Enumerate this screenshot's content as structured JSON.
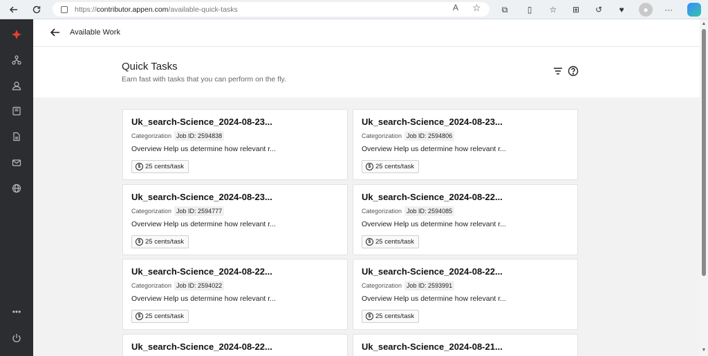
{
  "browser": {
    "url_prefix": "https://",
    "url_host": "contributor.appen.com",
    "url_path": "/available-quick-tasks",
    "read_aloud_label": "A"
  },
  "topbar": {
    "title": "Available Work"
  },
  "header": {
    "title": "Quick Tasks",
    "subtitle": "Earn fast with tasks that you can perform on the fly."
  },
  "tasks": [
    {
      "title": "Uk_search-Science_2024-08-23...",
      "category": "Categorization",
      "job_id": "Job ID: 2594838",
      "description": "Overview Help us determine how relevant r...",
      "pay": "25 cents/task"
    },
    {
      "title": "Uk_search-Science_2024-08-23...",
      "category": "Categorization",
      "job_id": "Job ID: 2594806",
      "description": "Overview Help us determine how relevant r...",
      "pay": "25 cents/task"
    },
    {
      "title": "Uk_search-Science_2024-08-23...",
      "category": "Categorization",
      "job_id": "Job ID: 2594777",
      "description": "Overview Help us determine how relevant r...",
      "pay": "25 cents/task"
    },
    {
      "title": "Uk_search-Science_2024-08-22...",
      "category": "Categorization",
      "job_id": "Job ID: 2594085",
      "description": "Overview Help us determine how relevant r...",
      "pay": "25 cents/task"
    },
    {
      "title": "Uk_search-Science_2024-08-22...",
      "category": "Categorization",
      "job_id": "Job ID: 2594022",
      "description": "Overview Help us determine how relevant r...",
      "pay": "25 cents/task"
    },
    {
      "title": "Uk_search-Science_2024-08-22...",
      "category": "Categorization",
      "job_id": "Job ID: 2593991",
      "description": "Overview Help us determine how relevant r...",
      "pay": "25 cents/task"
    },
    {
      "title": "Uk_search-Science_2024-08-22...",
      "category": "",
      "job_id": "",
      "description": "",
      "pay": ""
    },
    {
      "title": "Uk_search-Science_2024-08-21...",
      "category": "",
      "job_id": "",
      "description": "",
      "pay": ""
    }
  ],
  "colors": {
    "brand": "#e8402a",
    "sidebar_bg": "#2b2d31"
  },
  "sidebar_icons": [
    "appen-logo-icon",
    "hierarchy-icon",
    "profile-icon",
    "book-icon",
    "document-icon",
    "mail-icon",
    "globe-icon",
    "more-icon",
    "power-icon"
  ]
}
